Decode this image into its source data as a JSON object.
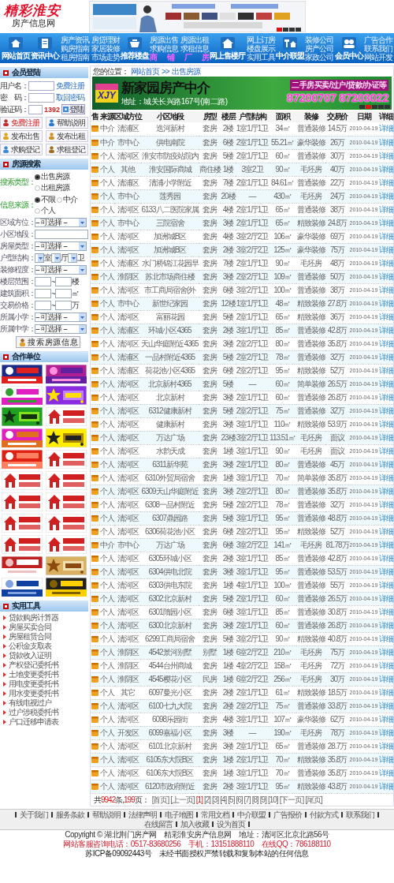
{
  "logo": {
    "title": "精彩淮安",
    "subtitle": "房产信息网"
  },
  "top_banner": {
    "kind": "picture",
    "slides": [
      {
        "selected": true
      },
      {
        "selected": false
      },
      {
        "selected": false
      },
      {
        "selected": false
      }
    ]
  },
  "nav": [
    {
      "label": "网站首页"
    },
    {
      "label": "资讯中心",
      "links": [
        "房产资讯",
        "房贷理财",
        "购房指南",
        "家居装修",
        "租房指南",
        "市场走势"
      ]
    },
    {
      "label": "推荐楼盘",
      "links": [
        "房源出售",
        "房源出租",
        "求购信息",
        "求租信息"
      ],
      "highlight_links": [
        "商",
        "铺",
        "厂",
        "房"
      ]
    },
    {
      "label": "网上售楼厅",
      "links": [
        "网上订房",
        "楼盘展示",
        "实用工具"
      ]
    },
    {
      "label": "中介联盟",
      "links": [
        "装修公司",
        "房产公司",
        "家政公司"
      ]
    },
    {
      "label": "会员中心",
      "links": [
        "广告合作",
        "联系我们",
        "网站开发"
      ]
    }
  ],
  "login": {
    "title": "会员登陆",
    "rows": [
      {
        "label": "用户名：",
        "link": "免费注册"
      },
      {
        "label": "密　码：",
        "link": "取回密码"
      },
      {
        "label": "验证码：",
        "captcha": "1392",
        "button": "登陆"
      }
    ],
    "buttons": [
      "免费注册",
      "帮助说明",
      "发布出售",
      "发布出租",
      "求购登记",
      "求租登记"
    ]
  },
  "search": {
    "title": "房源搜索",
    "rows": [
      {
        "kind": "radio",
        "label": "搜索类型：",
        "options": [
          {
            "label": "出售房源",
            "selected": true
          },
          {
            "label": "出租房源",
            "selected": false
          }
        ]
      },
      {
        "kind": "radio",
        "label": "信息来源：",
        "options": [
          {
            "label": "不限",
            "selected": true
          },
          {
            "label": "中介",
            "selected": false
          },
          {
            "label": "个人",
            "selected": false
          }
        ]
      },
      {
        "kind": "select",
        "label": "区域方位：",
        "value": "-- 可选择 --"
      },
      {
        "kind": "input",
        "label": "小区地段："
      },
      {
        "kind": "select",
        "label": "房屋类型：",
        "value": "-- 可选择 --"
      },
      {
        "kind": "layout",
        "label": "户型结构：",
        "units": [
          "室",
          "厅",
          "卫"
        ]
      },
      {
        "kind": "select",
        "label": "装修程度：",
        "value": "-- 可选择 --"
      },
      {
        "kind": "range",
        "label": "楼层范围：",
        "separator": "~",
        "unit": "楼"
      },
      {
        "kind": "range",
        "label": "建筑面积：",
        "separator": "~",
        "unit": "㎡"
      },
      {
        "kind": "range",
        "label": "交易价格：",
        "separator": "~",
        "unit": "万"
      },
      {
        "kind": "select",
        "label": "所属小学：",
        "value": "-- 可选择 --"
      },
      {
        "kind": "select",
        "label": "所属中学：",
        "value": "-- 可选择 --"
      }
    ],
    "button": "搜 索 房 源 信 息"
  },
  "partners": {
    "title": "合作单位"
  },
  "tools": {
    "title": "实用工具",
    "links": [
      "贷款购房计算器",
      "房屋买卖合同",
      "房屋租赁合同",
      "公积金支取表",
      "贷款收入证明",
      "产权登记委托书",
      "土地变更委托书",
      "用电变更委托书",
      "用水变更委托书",
      "有线电视过户",
      "过户涉税委托书",
      "户口迁移申请表"
    ]
  },
  "breadcrumb": {
    "label": "您的位置：",
    "links": [
      "网站首页",
      "出售房源"
    ],
    "separator": ">>"
  },
  "banner": {
    "logo": "XJY",
    "name": "新家园房产中介",
    "address": "地址：城关长兴路167号(南二路)",
    "services": "二手房买卖/过户/贷款/办证等",
    "phones": "87200707 87203022",
    "slides": [
      {
        "selected": false
      },
      {
        "selected": true
      },
      {
        "selected": false
      },
      {
        "selected": false
      },
      {
        "selected": false
      }
    ]
  },
  "table": {
    "columns": [
      "售",
      "来源",
      "区域方位",
      "小区地段",
      "房型",
      "楼层",
      "户型结构",
      "面积",
      "装修",
      "交易价",
      "日期",
      "详细"
    ],
    "rows": [
      [
        "",
        "中介",
        "清浦区",
        "迭河新村",
        "套房",
        "2楼",
        "1室1厅1卫",
        "34㎡",
        "普通装修",
        "14.5万",
        "2010-04-19",
        "详细"
      ],
      [
        "",
        "中介",
        "市中心",
        "供电南院",
        "套房",
        "6楼",
        "2室1厅1卫",
        "55.21㎡",
        "豪华装修",
        "26万",
        "2010-04-19",
        "详细"
      ],
      [
        "",
        "个人",
        "清河区",
        "淮安市防疫站院内",
        "套房",
        "5楼",
        "2室1厅1卫",
        "60㎡",
        "普通装修",
        "30万",
        "2010-04-19",
        "详细"
      ],
      [
        "",
        "个人",
        "其他",
        "淮安国际商城",
        "商住楼",
        "1楼",
        "3室2卫",
        "90㎡",
        "毛坯房",
        "40万",
        "2010-04-19",
        "详细"
      ],
      [
        "",
        "个人",
        "清浦区",
        "清浦小学附近",
        "套房",
        "7楼",
        "2室1厅1卫",
        "84.61㎡",
        "普通装修",
        "22万",
        "2010-04-19",
        "详细"
      ],
      [
        "",
        "个人",
        "市中心",
        "莲秀园",
        "套房",
        "20楼",
        "—",
        "430㎡",
        "毛坯房",
        "24万",
        "2010-04-19",
        "详细"
      ],
      [
        "",
        "个人",
        "清河区",
        "6133八二医院家属",
        "套房",
        "4楼",
        "2室1厅1卫",
        "65㎡",
        "普通装修",
        "38万",
        "2010-04-19",
        "详细"
      ],
      [
        "",
        "个人",
        "市中心",
        "三院宿舍",
        "套房",
        "3楼",
        "2室1厅1卫",
        "65㎡",
        "精致装修",
        "24.8万",
        "2010-04-19",
        "详细"
      ],
      [
        "",
        "个人",
        "清河区",
        "加洲城B区",
        "套房",
        "4楼",
        "3室2厅2卫",
        "106㎡",
        "豪华装修",
        "69万",
        "2010-04-19",
        "详细"
      ],
      [
        "",
        "个人",
        "清河区",
        "加洲城B区",
        "套房",
        "2楼",
        "3室2厅2卫",
        "125㎡",
        "豪华装修",
        "75万",
        "2010-04-19",
        "详细"
      ],
      [
        "",
        "个人",
        "清浦区",
        "水门桥锦江花园早",
        "套房",
        "7楼",
        "2室1厅1卫",
        "90㎡",
        "毛坯房",
        "48万",
        "2010-04-19",
        "详细"
      ],
      [
        "",
        "个人",
        "淮阴区",
        "苏北市场商住楼",
        "套房",
        "3楼",
        "2室2厅1卫",
        "109㎡",
        "普通装修",
        "50万",
        "2010-04-19",
        "详细"
      ],
      [
        "",
        "个人",
        "清河区",
        "市工商局宿舍(外",
        "套房",
        "6楼",
        "3室2厅1卫",
        "100㎡",
        "普通装修",
        "38万",
        "2010-04-19",
        "详细"
      ],
      [
        "",
        "个人",
        "市中心",
        "新世纪家园",
        "套房",
        "12楼",
        "1室1厅1卫",
        "48㎡",
        "精致装修",
        "27.8万",
        "2010-04-19",
        "详细"
      ],
      [
        "",
        "个人",
        "清河区",
        "富丽花园",
        "套房",
        "5楼",
        "2室1厅1卫",
        "65㎡",
        "精致装修",
        "36万",
        "2010-04-19",
        "详细"
      ],
      [
        "",
        "个人",
        "清浦区",
        "环城小区4365",
        "套房",
        "2楼",
        "3室1厅1卫",
        "85㎡",
        "普通装修",
        "42.8万",
        "2010-04-19",
        "详细"
      ],
      [
        "",
        "个人",
        "清河区",
        "天山华庭附近4365",
        "套房",
        "3楼",
        "2室2厅1卫",
        "80㎡",
        "普通装修",
        "35.8万",
        "2010-04-19",
        "详细"
      ],
      [
        "",
        "个人",
        "清浦区",
        "一品村附近4365",
        "套房",
        "5楼",
        "2室2厅1卫",
        "78㎡",
        "普通装修",
        "32万",
        "2010-04-19",
        "详细"
      ],
      [
        "",
        "个人",
        "清浦区",
        "荷花池小区4365",
        "套房",
        "6楼",
        "2室2厅1卫",
        "95㎡",
        "精致装修",
        "52万",
        "2010-04-19",
        "详细"
      ],
      [
        "",
        "个人",
        "清河区",
        "北京新村4365",
        "套房",
        "5楼",
        "—",
        "60㎡",
        "简单装修",
        "26.5万",
        "2010-04-19",
        "详细"
      ],
      [
        "",
        "个人",
        "清河区",
        "北京新村",
        "套房",
        "3楼",
        "2室1厅1卫",
        "60㎡",
        "普通装修",
        "26.8万",
        "2010-04-19",
        "详细"
      ],
      [
        "",
        "个人",
        "清河区",
        "6312健康新村",
        "套房",
        "5楼",
        "2室2厅1卫",
        "75㎡",
        "普通装修",
        "32万",
        "2010-04-19",
        "详细"
      ],
      [
        "",
        "个人",
        "清河区",
        "健康新村",
        "套房",
        "3楼",
        "3室1厅1卫",
        "110㎡",
        "精致装修",
        "53.9万",
        "2010-04-19",
        "详细"
      ],
      [
        "",
        "个人",
        "清河区",
        "万达广场",
        "套房",
        "23楼",
        "3室2厅1卫",
        "113.51㎡",
        "毛坯房",
        "面议",
        "2010-04-19",
        "详细"
      ],
      [
        "",
        "个人",
        "清河区",
        "水韵天成",
        "套房",
        "1楼",
        "3室1厅1卫",
        "90㎡",
        "毛坯房",
        "面议",
        "2010-04-19",
        "详细"
      ],
      [
        "",
        "个人",
        "清河区",
        "6311新华苑",
        "套房",
        "3楼",
        "2室1厅1卫",
        "80㎡",
        "普通装修",
        "45万",
        "2010-04-19",
        "详细"
      ],
      [
        "",
        "个人",
        "清河区",
        "6310外贸局宿舍",
        "套房",
        "1楼",
        "3室1厅1卫",
        "70㎡",
        "简单装修",
        "35.8万",
        "2010-04-19",
        "详细"
      ],
      [
        "",
        "个人",
        "清河区",
        "6309天山华庭附近",
        "套房",
        "3楼",
        "2室2厅1卫",
        "80㎡",
        "普通装修",
        "35.8万",
        "2010-04-19",
        "详细"
      ],
      [
        "",
        "个人",
        "清河区",
        "6308一品村附近",
        "套房",
        "5楼",
        "2室2厅1卫",
        "78㎡",
        "普通装修",
        "32万",
        "2010-04-19",
        "详细"
      ],
      [
        "",
        "个人",
        "清河区",
        "6307鼎园路",
        "套房",
        "5楼",
        "3室1厅1卫",
        "95㎡",
        "普通装修",
        "48.8万",
        "2010-04-19",
        "详细"
      ],
      [
        "",
        "个人",
        "清河区",
        "6306荷花池小区",
        "套房",
        "6楼",
        "2室2厅1卫",
        "95㎡",
        "精致装修",
        "52万",
        "2010-04-19",
        "详细"
      ],
      [
        "",
        "中介",
        "市中心",
        "万达广场",
        "套房",
        "6楼",
        "3室2厅2卫",
        "141㎡",
        "毛坯房",
        "81.78万",
        "2010-04-19",
        "详细"
      ],
      [
        "",
        "个人",
        "清河区",
        "6305环城小区",
        "套房",
        "2楼",
        "3室1厅1卫",
        "85㎡",
        "普通装修",
        "42.8万",
        "2010-04-19",
        "详细"
      ],
      [
        "",
        "个人",
        "清河区",
        "6304供电北院",
        "套房",
        "3楼",
        "3室1厅1卫",
        "95㎡",
        "普通装修",
        "53.5万",
        "2010-04-19",
        "详细"
      ],
      [
        "",
        "个人",
        "清河区",
        "6303供电东院",
        "套房",
        "1楼",
        "4室1厅1卫",
        "100㎡",
        "普通装修",
        "55万",
        "2010-04-19",
        "详细"
      ],
      [
        "",
        "个人",
        "清河区",
        "6302北京新村",
        "套房",
        "5楼",
        "2室1厅1卫",
        "60㎡",
        "普通装修",
        "26.5万",
        "2010-04-19",
        "详细"
      ],
      [
        "",
        "个人",
        "清河区",
        "6301隋园小区",
        "套房",
        "6楼",
        "3室1厅1卫",
        "85㎡",
        "普通装修",
        "30.8万",
        "2010-04-19",
        "详细"
      ],
      [
        "",
        "个人",
        "清河区",
        "6300北京新村",
        "套房",
        "3楼",
        "2室1厅1卫",
        "60㎡",
        "普通装修",
        "26.8万",
        "2010-04-19",
        "详细"
      ],
      [
        "",
        "个人",
        "清河区",
        "6299工商局宿舍",
        "套房",
        "5楼",
        "3室2厅1卫",
        "90㎡",
        "精致装修",
        "40.8万",
        "2010-04-19",
        "详细"
      ],
      [
        "",
        "个人",
        "淮阴区",
        "4542景河别墅",
        "别墅",
        "1楼",
        "6室2厅2卫",
        "210㎡",
        "毛坯房",
        "75万",
        "2010-04-19",
        "详细"
      ],
      [
        "",
        "个人",
        "淮阴区",
        "4544台州商城",
        "套房",
        "1楼",
        "4室2厅2卫",
        "158㎡",
        "毛坯房",
        "72万",
        "2010-04-19",
        "详细"
      ],
      [
        "",
        "个人",
        "淮阴区",
        "4545樱花小区",
        "民房",
        "1楼",
        "6室2厅2卫",
        "256㎡",
        "毛坯房",
        "30万",
        "2010-04-19",
        "详细"
      ],
      [
        "",
        "个人",
        "其它",
        "6097曼光小区",
        "套房",
        "2楼",
        "2室1厅1卫",
        "61㎡",
        "精致装修",
        "18.5万",
        "2010-04-19",
        "详细"
      ],
      [
        "",
        "个人",
        "清河区",
        "6100七九大院",
        "套房",
        "2楼",
        "2室2厅1卫",
        "75㎡",
        "普通装修",
        "33.8万",
        "2010-04-19",
        "详细"
      ],
      [
        "",
        "个人",
        "清河区",
        "6098乐园街",
        "套房",
        "4楼",
        "3室1厅1卫",
        "107㎡",
        "豪华装修",
        "62万",
        "2010-04-19",
        "详细"
      ],
      [
        "",
        "个人",
        "开发区",
        "6099嘉福小区",
        "套房",
        "3楼",
        "—",
        "190㎡",
        "毛坯房",
        "78万",
        "2010-04-19",
        "详细"
      ],
      [
        "",
        "个人",
        "清河区",
        "6101北京新村",
        "套房",
        "3楼",
        "2室1厅1卫",
        "65㎡",
        "普通装修",
        "28.7万",
        "2010-04-19",
        "详细"
      ],
      [
        "",
        "个人",
        "清河区",
        "6105东大院B区",
        "套房",
        "1楼",
        "2室1厅1卫",
        "70㎡",
        "精致装修",
        "35.8万",
        "2010-04-19",
        "详细"
      ],
      [
        "",
        "个人",
        "清河区",
        "6106东大院B区",
        "套房",
        "1楼",
        "3室1厅1卫",
        "70㎡",
        "普通装修",
        "35.8万",
        "2010-04-19",
        "详细"
      ],
      [
        "",
        "个人",
        "清河区",
        "6120市政府附近",
        "套房",
        "2楼",
        "3室1厅1卫",
        "95㎡",
        "精致装修",
        "43.8万",
        "2010-04-19",
        "详细"
      ]
    ]
  },
  "pager": {
    "summary": [
      "共",
      "9942",
      "条,",
      "199",
      "页："
    ],
    "pages": [
      {
        "label": "[首页]",
        "selected": false
      },
      {
        "label": "[上一页]",
        "selected": false
      },
      {
        "label": "[1]",
        "selected": true
      },
      {
        "label": "[2]",
        "selected": false
      },
      {
        "label": "[3]",
        "selected": false
      },
      {
        "label": "[4]",
        "selected": false
      },
      {
        "label": "[5]",
        "selected": false
      },
      {
        "label": "[6]",
        "selected": false
      },
      {
        "label": "[7]",
        "selected": false
      },
      {
        "label": "[8]",
        "selected": false
      },
      {
        "label": "[9]",
        "selected": false
      },
      {
        "label": "[10]",
        "selected": false
      },
      {
        "label": "[下一页]",
        "selected": false
      },
      {
        "label": "[尾页]",
        "selected": false
      }
    ]
  },
  "footer": {
    "links": [
      "关于我们",
      "服务条款",
      "帮助说明",
      "法律声明",
      "电子地图",
      "常用文档",
      "中介联盟",
      "广告报价",
      "付款方式",
      "联系我们",
      "在线留言",
      "加入收藏",
      "设为首页"
    ],
    "copyright": "Copyright © 湖北荆门房产网　精彩淮安房产信息网　地址：清河区北京北路56号",
    "contact": "网站客服咨询电话：0517-83680256　手机：13151888110　在线QQ：786188110",
    "notice": "苏ICP备09092443号　未经书面授权严禁转载和复制本站的任何信息"
  }
}
